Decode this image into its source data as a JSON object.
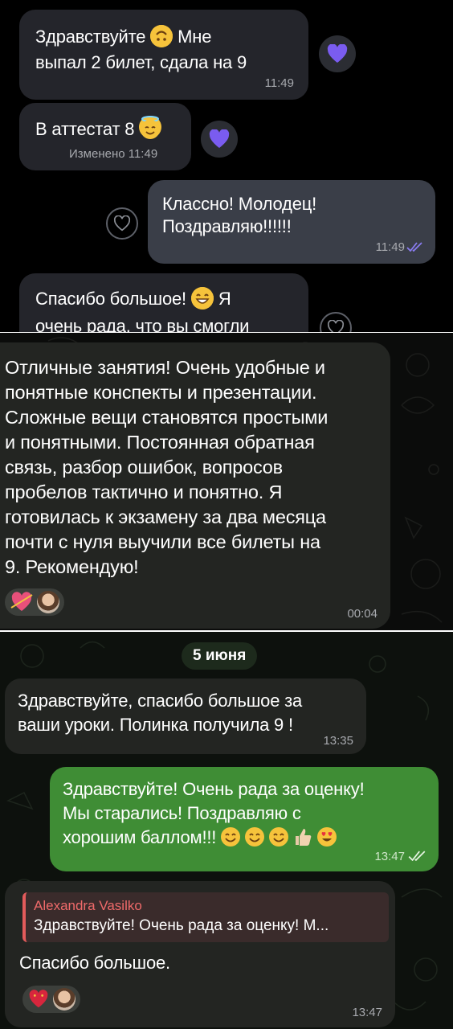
{
  "panel1": {
    "msg1": {
      "text_before": "Здравствуйте",
      "text_mid": "Мне",
      "text_line2": "выпал 2 билет, сдала на 9",
      "time": "11:49"
    },
    "msg2": {
      "text": "В  аттестат 8",
      "edited_label": "Изменено 11:49"
    },
    "msg3": {
      "line1": "Классно! Молодец!",
      "line2": "Поздравляю!!!!!!",
      "time": "11:49"
    },
    "msg4": {
      "line1": "Спасибо большое!",
      "line1_tail": "Я",
      "line2": "очень рада, что вы смогли"
    }
  },
  "panel2": {
    "msg": {
      "lines": [
        "Отличные занятия! Очень удобные и",
        "понятные конспекты и презентации.",
        "Сложные вещи становятся простыми",
        "и понятными. Постоянная обратная",
        "связь, разбор ошибок, вопросов",
        "пробелов тактично и понятно. Я",
        "готовилась к экзамену за два месяца",
        "почти с нуля выучили все билеты на",
        "9. Рекомендую!"
      ],
      "time": "00:04"
    }
  },
  "panel3": {
    "date": "5 июня",
    "msg1": {
      "line1": "Здравствуйте, спасибо большое за",
      "line2": "ваши уроки. Полинка получила 9 !",
      "time": "13:35"
    },
    "msg2": {
      "line1": "Здравствуйте! Очень рада за оценку!",
      "line2": "Мы старались! Поздравляю с",
      "line3": "хорошим баллом!!!",
      "time": "13:47"
    },
    "msg3": {
      "reply_name": "Alexandra Vasilko",
      "reply_text": "Здравствуйте! Очень рада за оценку! М...",
      "text": "Спасибо большое.",
      "time": "13:47"
    }
  },
  "colors": {
    "accent_purple": "#7a5cf0",
    "outgoing_green": "#3f8d35",
    "reply_red": "#ef6a6a"
  },
  "icons": [
    "heart-icon",
    "double-check-icon",
    "heart-arrow-emoji",
    "heart-emoji",
    "smile-emoji",
    "halo-emoji",
    "grin-emoji",
    "thumbs-up-emoji",
    "heart-eyes-emoji"
  ]
}
